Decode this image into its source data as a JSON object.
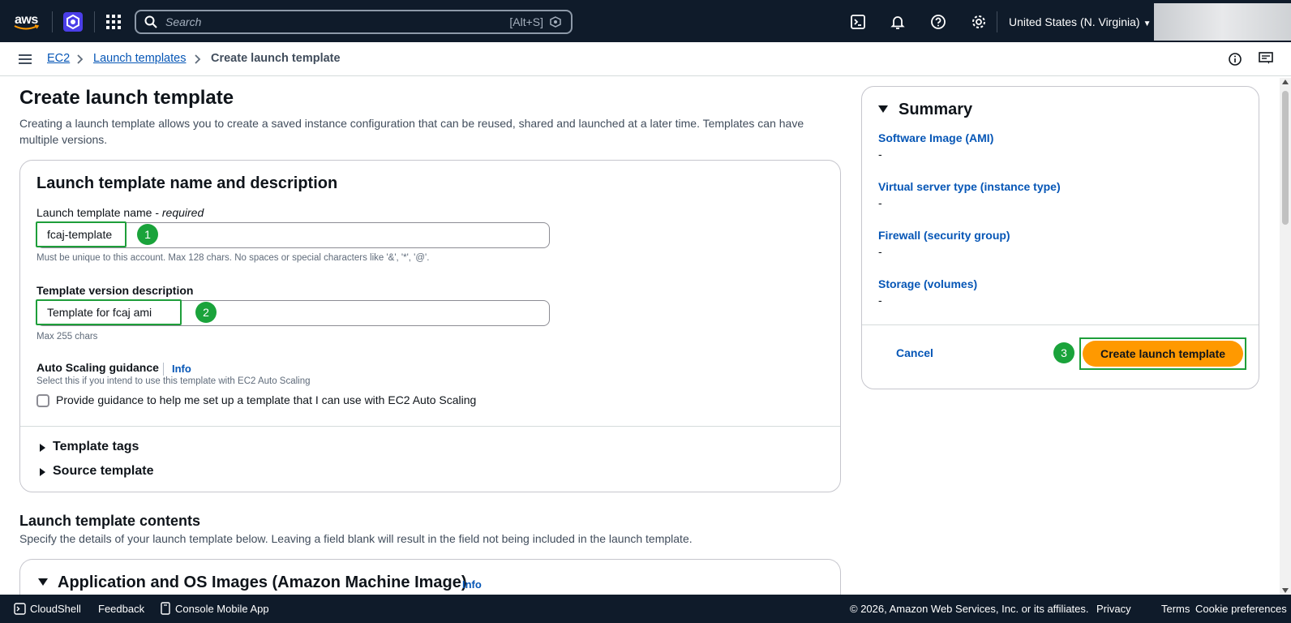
{
  "topnav": {
    "logo_text": "aws",
    "search_placeholder": "Search",
    "search_shortcut": "[Alt+S]",
    "region": "United States (N. Virginia)"
  },
  "breadcrumb": {
    "items": [
      "EC2",
      "Launch templates",
      "Create launch template"
    ]
  },
  "page": {
    "title": "Create launch template",
    "description": "Creating a launch template allows you to create a saved instance configuration that can be reused, shared and launched at a later time. Templates can have multiple versions."
  },
  "name_section": {
    "title": "Launch template name and description",
    "name_label": "Launch template name - ",
    "name_required": "required",
    "name_value": "fcaj-template",
    "name_hint": "Must be unique to this account. Max 128 chars. No spaces or special characters like '&', '*', '@'.",
    "version_label": "Template version description",
    "version_value": "Template for fcaj ami",
    "version_hint": "Max 255 chars",
    "autoscaling_label": "Auto Scaling guidance",
    "info": "Info",
    "autoscaling_hint": "Select this if you intend to use this template with EC2 Auto Scaling",
    "autoscaling_checkbox": "Provide guidance to help me set up a template that I can use with EC2 Auto Scaling",
    "template_tags": "Template tags",
    "source_template": "Source template"
  },
  "badges": [
    "1",
    "2",
    "3"
  ],
  "contents": {
    "title": "Launch template contents",
    "description": "Specify the details of your launch template below. Leaving a field blank will result in the field not being included in the launch template.",
    "ami_title": "Application and OS Images (Amazon Machine Image)",
    "ami_info": "Info"
  },
  "summary": {
    "title": "Summary",
    "items": [
      {
        "key": "Software Image (AMI)",
        "value": "-"
      },
      {
        "key": "Virtual server type (instance type)",
        "value": "-"
      },
      {
        "key": "Firewall (security group)",
        "value": "-"
      },
      {
        "key": "Storage (volumes)",
        "value": "-"
      }
    ],
    "cancel": "Cancel",
    "create": "Create launch template"
  },
  "footer": {
    "cloudshell": "CloudShell",
    "feedback": "Feedback",
    "mobile_app": "Console Mobile App",
    "copyright": "© 2026, Amazon Web Services, Inc. or its affiliates.",
    "privacy": "Privacy",
    "terms": "Terms",
    "cookies": "Cookie preferences"
  },
  "colors": {
    "nav_bg": "#0f1b2a",
    "link": "#0656b6",
    "primary_button": "#ff9900",
    "highlight": "#1e9e3a"
  }
}
